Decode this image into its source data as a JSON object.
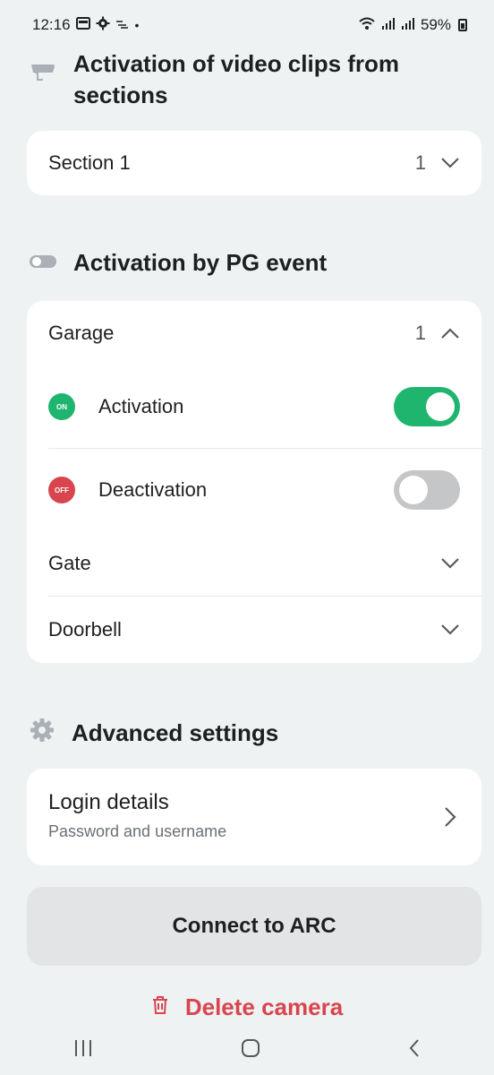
{
  "status_bar": {
    "time": "12:16",
    "icons_left": [
      "gallery-icon",
      "gear-icon",
      "wind-icon",
      "dot"
    ],
    "battery": "59%",
    "icons_right": [
      "wifi-icon",
      "signal-icon",
      "signal-icon",
      "battery-icon"
    ]
  },
  "video_sections": {
    "header": "Activation of video clips from sections",
    "icon": "camera-icon",
    "items": [
      {
        "label": "Section 1",
        "count": "1"
      }
    ]
  },
  "pg_event": {
    "header": "Activation by PG event",
    "icon": "toggle-icon",
    "groups": [
      {
        "label": "Garage",
        "count": "1",
        "expanded": true,
        "options": [
          {
            "badge": "ON",
            "label": "Activation",
            "enabled": true,
            "badge_color": "#1fb56f"
          },
          {
            "badge": "OFF",
            "label": "Deactivation",
            "enabled": false,
            "badge_color": "#d9454e"
          }
        ]
      },
      {
        "label": "Gate",
        "expanded": false
      },
      {
        "label": "Doorbell",
        "expanded": false
      }
    ]
  },
  "advanced": {
    "header": "Advanced settings",
    "icon": "gear-icon",
    "login": {
      "title": "Login details",
      "subtitle": "Password and username"
    }
  },
  "actions": {
    "connect_label": "Connect to ARC",
    "delete_label": "Delete camera"
  },
  "colors": {
    "accent_green": "#1fb56f",
    "danger_red": "#d9454e",
    "background": "#eef2f3"
  },
  "nav": [
    "recent-apps-icon",
    "home-icon",
    "back-icon"
  ]
}
